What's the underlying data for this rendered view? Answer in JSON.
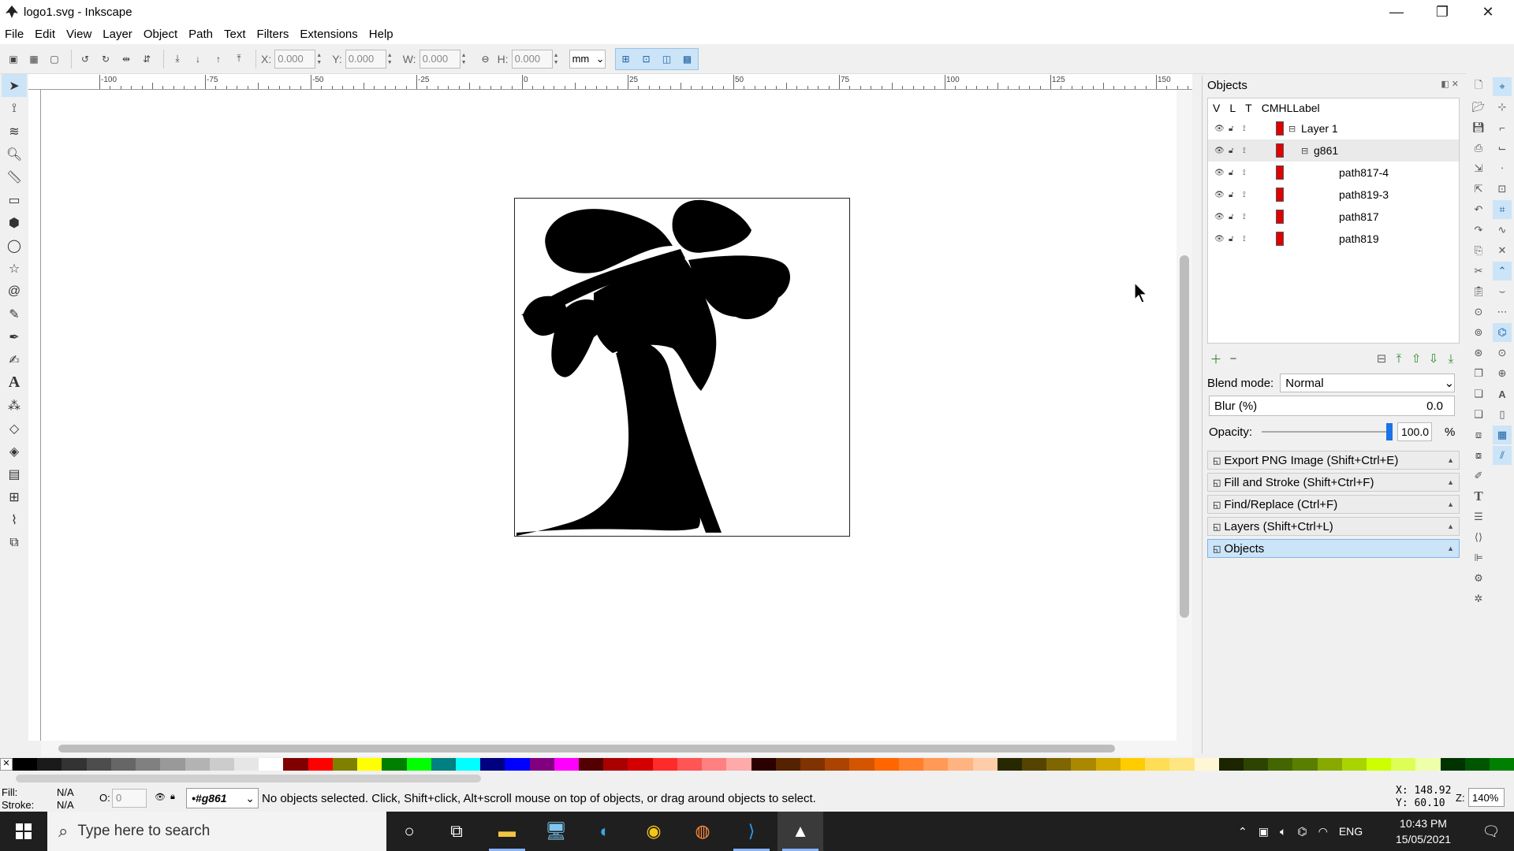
{
  "window": {
    "title": "logo1.svg - Inkscape",
    "controls": {
      "minimize": "—",
      "maximize": "❐",
      "close": "✕"
    }
  },
  "menu": [
    "File",
    "Edit",
    "View",
    "Layer",
    "Object",
    "Path",
    "Text",
    "Filters",
    "Extensions",
    "Help"
  ],
  "toolbar": {
    "x_label": "X:",
    "x_value": "0.000",
    "y_label": "Y:",
    "y_value": "0.000",
    "w_label": "W:",
    "w_value": "0.000",
    "h_label": "H:",
    "h_value": "0.000",
    "unit": "mm"
  },
  "ruler_top": [
    "-100",
    "-75",
    "-50",
    "-25",
    "0",
    "25",
    "50",
    "75",
    "100",
    "125",
    "150"
  ],
  "objects_panel": {
    "title": "Objects",
    "columns": [
      "V",
      "L",
      "T",
      "CM",
      "HL",
      "Label"
    ],
    "rows": [
      {
        "label": "Layer 1",
        "indent": 0,
        "expander": "⊟"
      },
      {
        "label": "g861",
        "indent": 1,
        "expander": "⊟",
        "selected": true
      },
      {
        "label": "path817-4",
        "indent": 2,
        "expander": ""
      },
      {
        "label": "path819-3",
        "indent": 2,
        "expander": ""
      },
      {
        "label": "path817",
        "indent": 2,
        "expander": ""
      },
      {
        "label": "path819",
        "indent": 2,
        "expander": ""
      }
    ],
    "blend_label": "Blend mode:",
    "blend_value": "Normal",
    "blur_label": "Blur (%)",
    "blur_value": "0.0",
    "opacity_label": "Opacity:",
    "opacity_value": "100.0",
    "opacity_unit": "%"
  },
  "dock_tabs": [
    {
      "label": "Export PNG Image (Shift+Ctrl+E)",
      "active": false
    },
    {
      "label": "Fill and Stroke (Shift+Ctrl+F)",
      "active": false
    },
    {
      "label": "Find/Replace (Ctrl+F)",
      "active": false
    },
    {
      "label": "Layers (Shift+Ctrl+L)",
      "active": false
    },
    {
      "label": "Objects",
      "active": true
    }
  ],
  "status": {
    "fill_label": "Fill:",
    "fill_value": "N/A",
    "stroke_label": "Stroke:",
    "stroke_value": "N/A",
    "opacity_label": "O:",
    "opacity_value": "0",
    "layer": "•#g861",
    "message": "No objects selected. Click, Shift+click, Alt+scroll mouse on top of objects, or drag around objects to select.",
    "x_coord": "X:  148.92",
    "y_coord": "Y:   60.10",
    "zoom_label": "Z:",
    "zoom_value": "140%"
  },
  "taskbar": {
    "search_placeholder": "Type here to search",
    "lang": "ENG",
    "time": "10:43 PM",
    "date": "15/05/2021"
  },
  "palette": [
    "#000000",
    "#1a1a1a",
    "#333333",
    "#4d4d4d",
    "#666666",
    "#808080",
    "#999999",
    "#b3b3b3",
    "#cccccc",
    "#e6e6e6",
    "#ffffff",
    "#800000",
    "#ff0000",
    "#808000",
    "#ffff00",
    "#008000",
    "#00ff00",
    "#008080",
    "#00ffff",
    "#000080",
    "#0000ff",
    "#800080",
    "#ff00ff",
    "#550000",
    "#aa0000",
    "#d40000",
    "#ff2a2a",
    "#ff5555",
    "#ff8080",
    "#ffaaaa",
    "#2b0000",
    "#552200",
    "#803300",
    "#aa4400",
    "#d45500",
    "#ff6600",
    "#ff7f2a",
    "#ff9955",
    "#ffb380",
    "#ffccaa",
    "#282800",
    "#554400",
    "#806600",
    "#aa8800",
    "#d4aa00",
    "#ffcc00",
    "#ffdd55",
    "#ffe680",
    "#fff6d5",
    "#1c2400",
    "#2d4400",
    "#446600",
    "#5a7f00",
    "#88aa00",
    "#aad400",
    "#ccff00",
    "#ddff55",
    "#eeffaa",
    "#003300",
    "#005500",
    "#008000"
  ]
}
